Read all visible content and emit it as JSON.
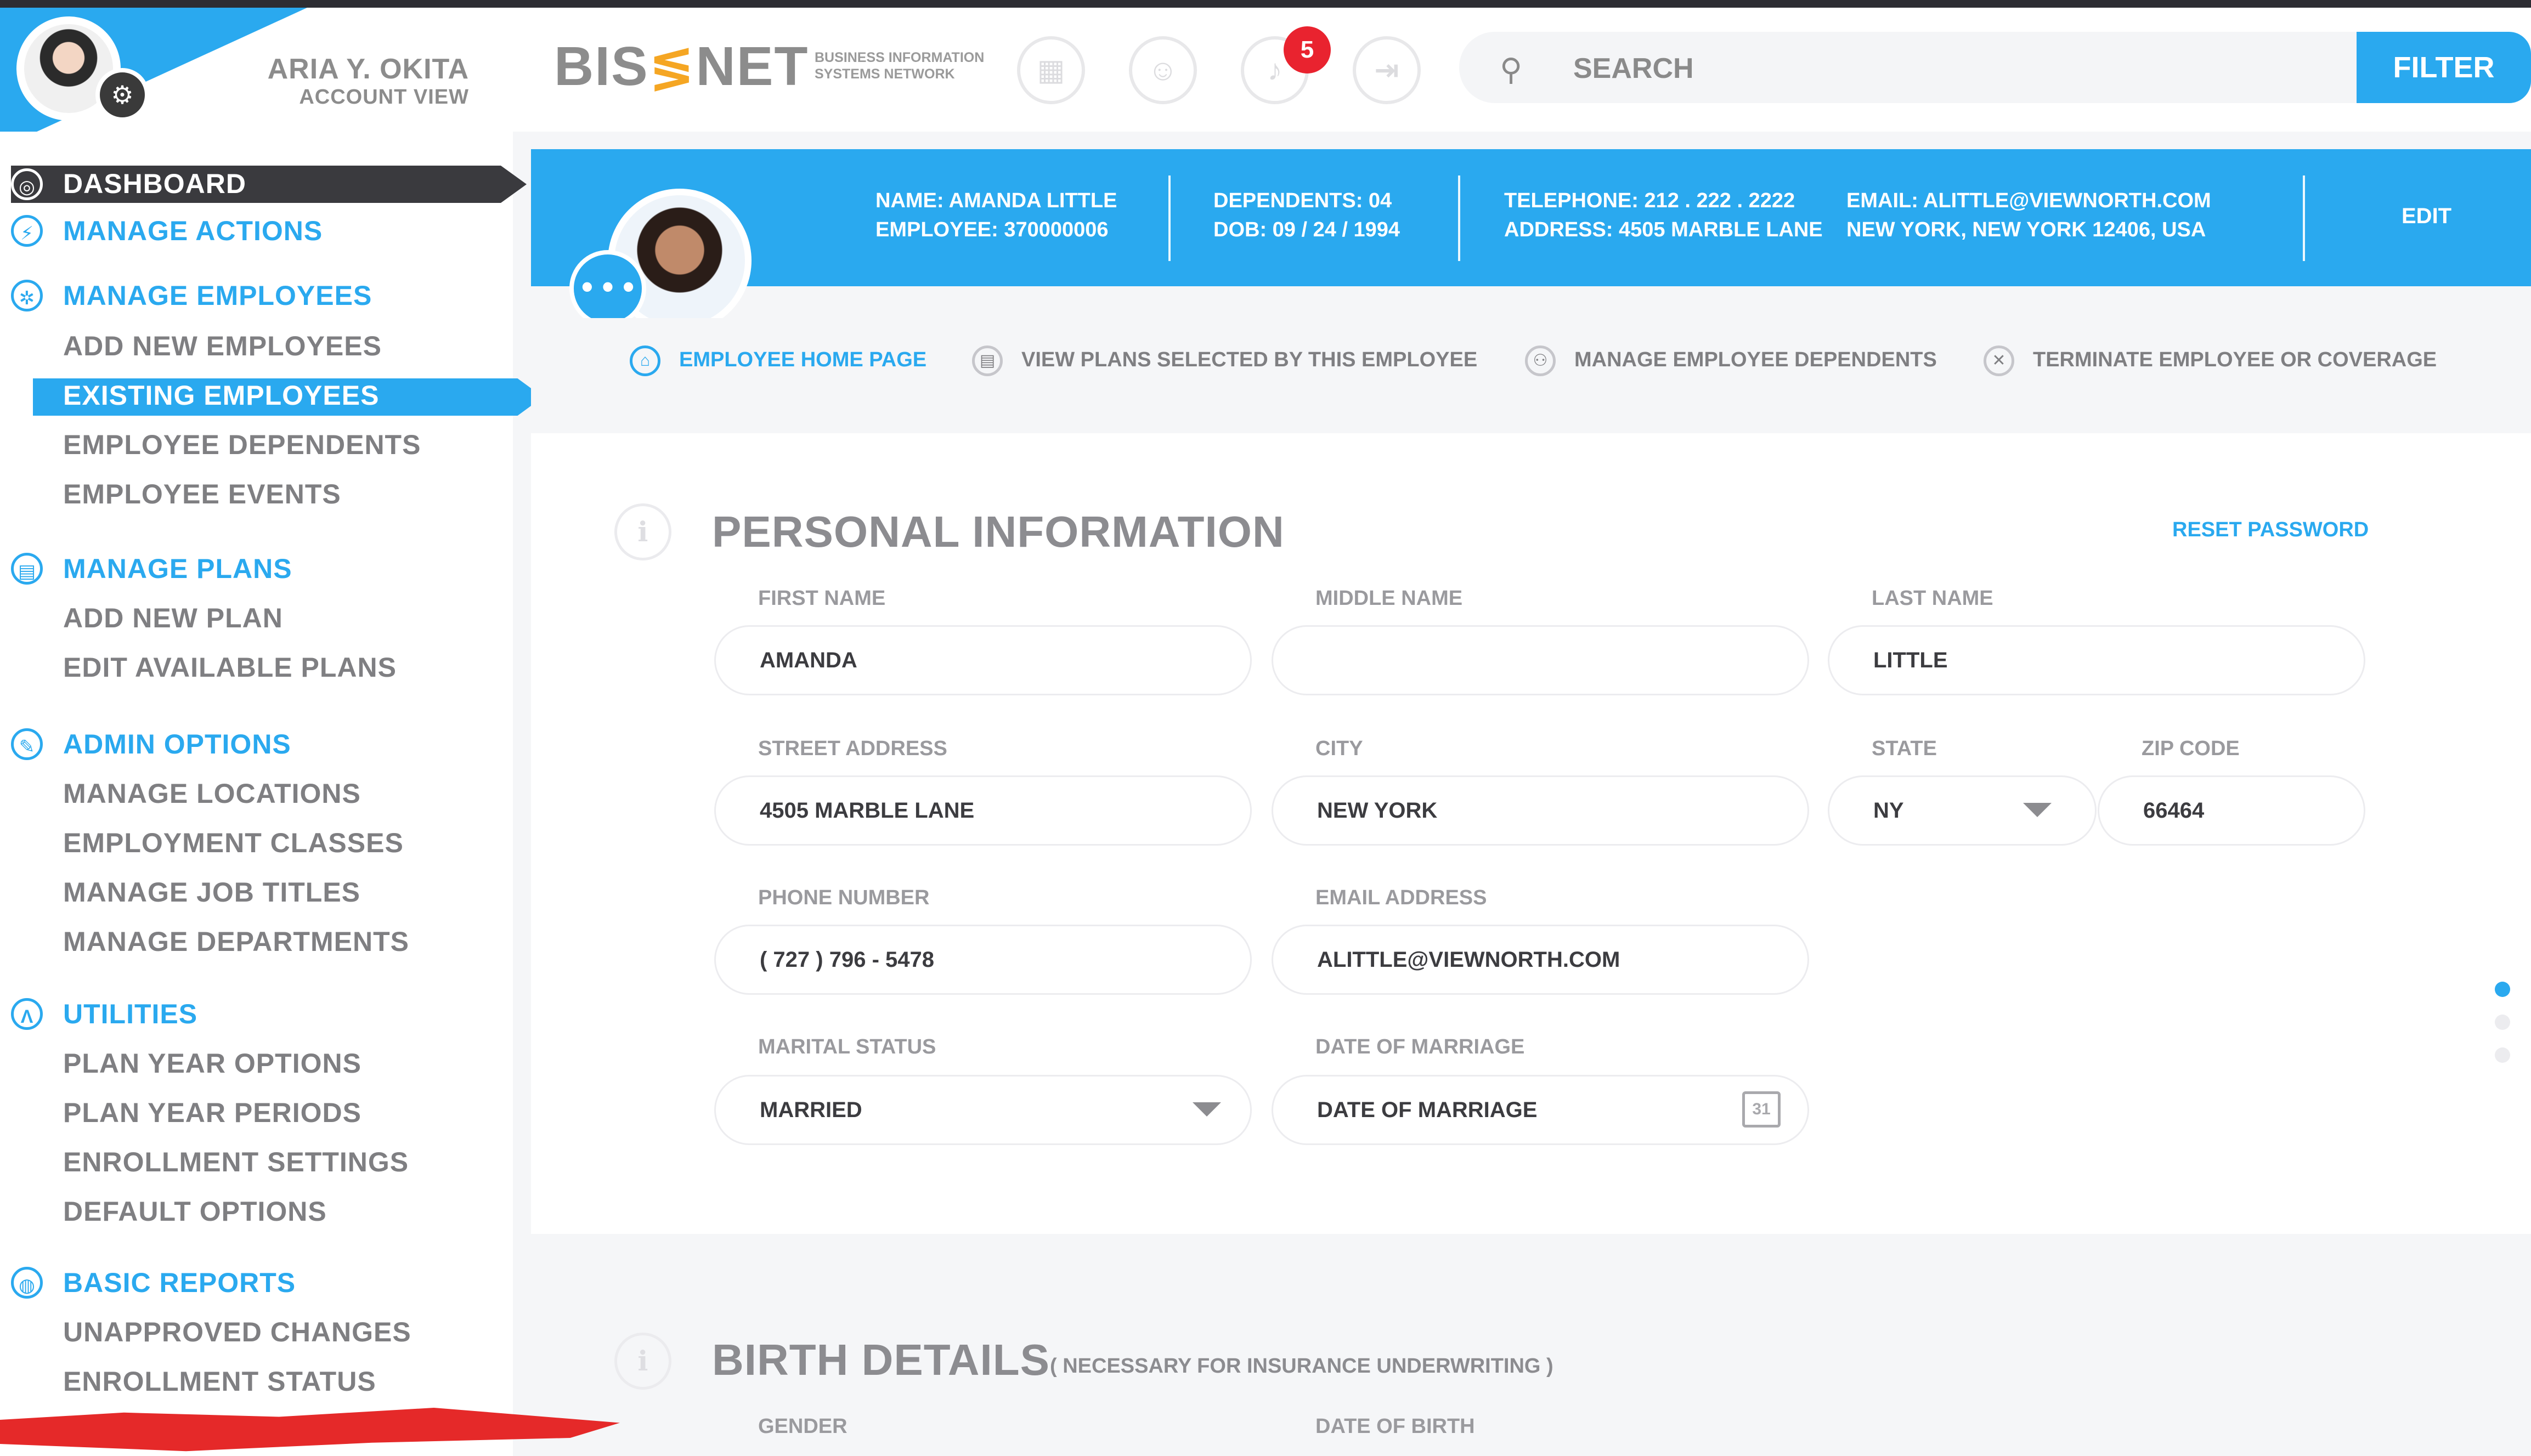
{
  "user": {
    "name": "ARIA Y. OKITA",
    "subtitle": "ACCOUNT VIEW"
  },
  "brand": {
    "logo_left": "BIS",
    "logo_right": "NET",
    "tagline_1": "BUSINESS INFORMATION",
    "tagline_2": "SYSTEMS NETWORK"
  },
  "header": {
    "notification_count": "5",
    "search_placeholder": "SEARCH",
    "filter_label": "FILTER",
    "icons": [
      "grid-icon",
      "support-icon",
      "bell-icon",
      "logout-icon"
    ]
  },
  "sidebar": {
    "dashboard": "DASHBOARD",
    "manage_actions": "MANAGE ACTIONS",
    "manage_employees": "MANAGE EMPLOYEES",
    "employees_items": [
      "ADD NEW EMPLOYEES",
      "EXISTING EMPLOYEES",
      "EMPLOYEE DEPENDENTS",
      "EMPLOYEE EVENTS"
    ],
    "manage_plans": "MANAGE PLANS",
    "plans_items": [
      "ADD NEW PLAN",
      "EDIT AVAILABLE PLANS"
    ],
    "admin_options": "ADMIN OPTIONS",
    "admin_items": [
      "MANAGE LOCATIONS",
      "EMPLOYMENT CLASSES",
      "MANAGE JOB TITLES",
      "MANAGE DEPARTMENTS"
    ],
    "utilities": "UTILITIES",
    "utilities_items": [
      "PLAN YEAR OPTIONS",
      "PLAN YEAR PERIODS",
      "ENROLLMENT SETTINGS",
      "DEFAULT OPTIONS"
    ],
    "basic_reports": "BASIC REPORTS",
    "reports_items": [
      "UNAPPROVED CHANGES",
      "ENROLLMENT STATUS"
    ]
  },
  "employee": {
    "name_line": "NAME: AMANDA LITTLE",
    "employee_line": "EMPLOYEE: 370000006",
    "dependents_line": "DEPENDENTS: 04",
    "dob_line": "DOB: 09 / 24 / 1994",
    "telephone_line": "TELEPHONE:  212 . 222 . 2222",
    "address_line": "ADDRESS:  4505 MARBLE LANE",
    "email_line": "EMAIL: ALITTLE@VIEWNORTH.COM",
    "city_line": "NEW YORK, NEW YORK 12406, USA",
    "edit_label": "EDIT"
  },
  "tabs": [
    "EMPLOYEE HOME PAGE",
    "VIEW PLANS SELECTED BY THIS EMPLOYEE",
    "MANAGE EMPLOYEE DEPENDENTS",
    "TERMINATE EMPLOYEE OR COVERAGE"
  ],
  "personal": {
    "title": "PERSONAL INFORMATION",
    "reset_password": "RESET PASSWORD",
    "labels": {
      "first_name": "FIRST NAME",
      "middle_name": "MIDDLE NAME",
      "last_name": "LAST NAME",
      "street": "STREET ADDRESS",
      "city": "CITY",
      "state": "STATE",
      "zip": "ZIP CODE",
      "phone": "PHONE NUMBER",
      "email": "EMAIL ADDRESS",
      "marital": "MARITAL STATUS",
      "marriage_date": "DATE OF MARRIAGE"
    },
    "values": {
      "first_name": "AMANDA",
      "middle_name": "",
      "last_name": "LITTLE",
      "street": "4505 MARBLE LANE",
      "city": "NEW YORK",
      "state": "NY",
      "zip": "66464",
      "phone": "( 727 ) 796 - 5478",
      "email": "ALITTLE@VIEWNORTH.COM",
      "marital": "MARRIED"
    },
    "placeholders": {
      "marriage_date": "DATE OF MARRIAGE"
    },
    "calendar_day": "31"
  },
  "birth": {
    "title": "BIRTH DETAILS",
    "note": "( NECESSARY FOR INSURANCE UNDERWRITING )",
    "labels": {
      "gender": "GENDER",
      "dob": "DATE OF BIRTH"
    }
  },
  "colors": {
    "accent": "#2aa9ef",
    "badge": "#e9232f",
    "logo_mark": "#f5a623",
    "dark": "#3a3a3e"
  }
}
